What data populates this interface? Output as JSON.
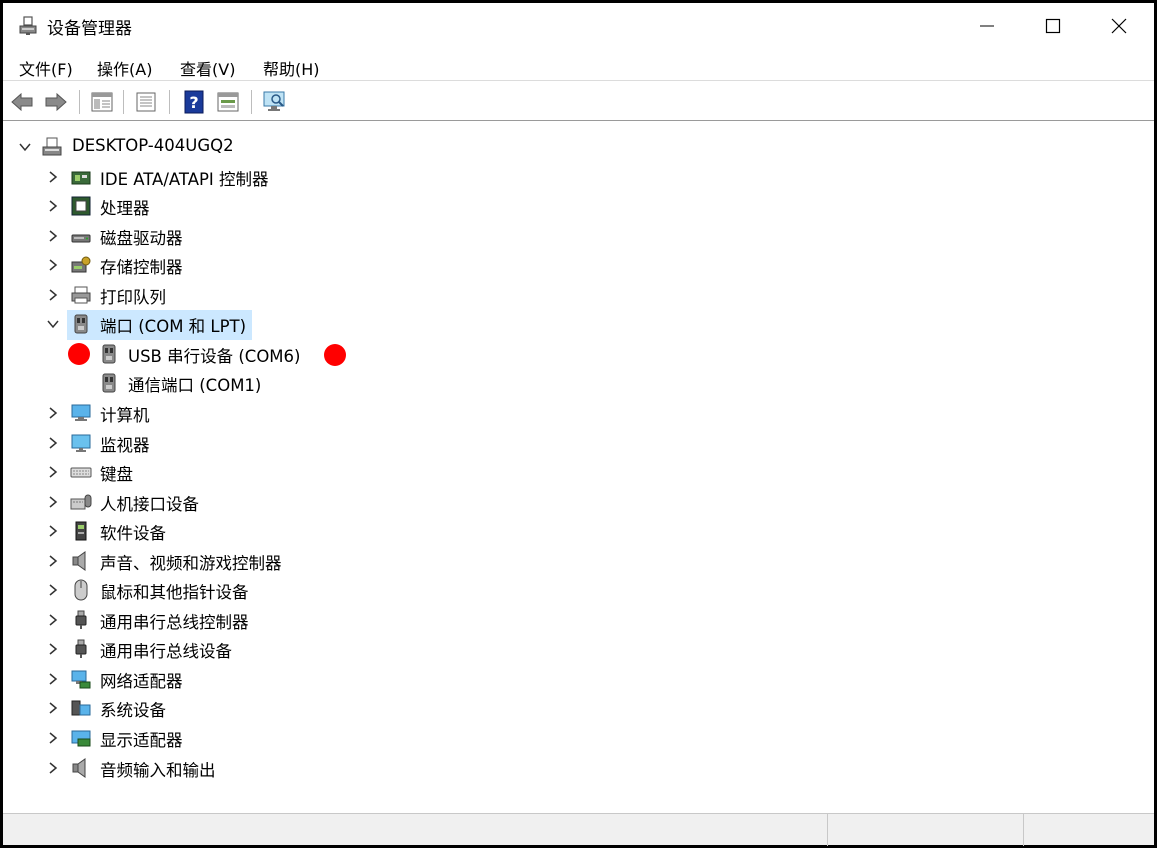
{
  "window": {
    "title": "设备管理器"
  },
  "menu": [
    "文件(F)",
    "操作(A)",
    "查看(V)",
    "帮助(H)"
  ],
  "toolbar": [
    "back-icon",
    "forward-icon",
    "properties-pane-icon",
    "properties-icon",
    "help-icon",
    "update-driver-icon",
    "scan-hardware-icon"
  ],
  "tree": {
    "root": "DESKTOP-404UGQ2",
    "categories": [
      {
        "label": "IDE ATA/ATAPI 控制器",
        "icon": "ide-controller-icon"
      },
      {
        "label": "处理器",
        "icon": "processor-icon"
      },
      {
        "label": "磁盘驱动器",
        "icon": "disk-drive-icon"
      },
      {
        "label": "存储控制器",
        "icon": "storage-controller-icon"
      },
      {
        "label": "打印队列",
        "icon": "printer-icon"
      },
      {
        "label": "端口 (COM 和 LPT)",
        "icon": "port-icon",
        "expanded": true,
        "children": [
          {
            "label": "USB 串行设备 (COM6)",
            "icon": "port-icon",
            "marked": true
          },
          {
            "label": "通信端口 (COM1)",
            "icon": "port-icon"
          }
        ]
      },
      {
        "label": "计算机",
        "icon": "computer-icon"
      },
      {
        "label": "监视器",
        "icon": "monitor-icon"
      },
      {
        "label": "键盘",
        "icon": "keyboard-icon"
      },
      {
        "label": "人机接口设备",
        "icon": "hid-icon"
      },
      {
        "label": "软件设备",
        "icon": "software-device-icon"
      },
      {
        "label": "声音、视频和游戏控制器",
        "icon": "speaker-icon"
      },
      {
        "label": "鼠标和其他指针设备",
        "icon": "mouse-icon"
      },
      {
        "label": "通用串行总线控制器",
        "icon": "usb-icon"
      },
      {
        "label": "通用串行总线设备",
        "icon": "usb-icon"
      },
      {
        "label": "网络适配器",
        "icon": "network-adapter-icon"
      },
      {
        "label": "系统设备",
        "icon": "system-device-icon"
      },
      {
        "label": "显示适配器",
        "icon": "display-adapter-icon"
      },
      {
        "label": "音频输入和输出",
        "icon": "speaker-icon"
      }
    ]
  },
  "colors": {
    "selection": "#cce8ff",
    "marker": "#ff0000"
  }
}
